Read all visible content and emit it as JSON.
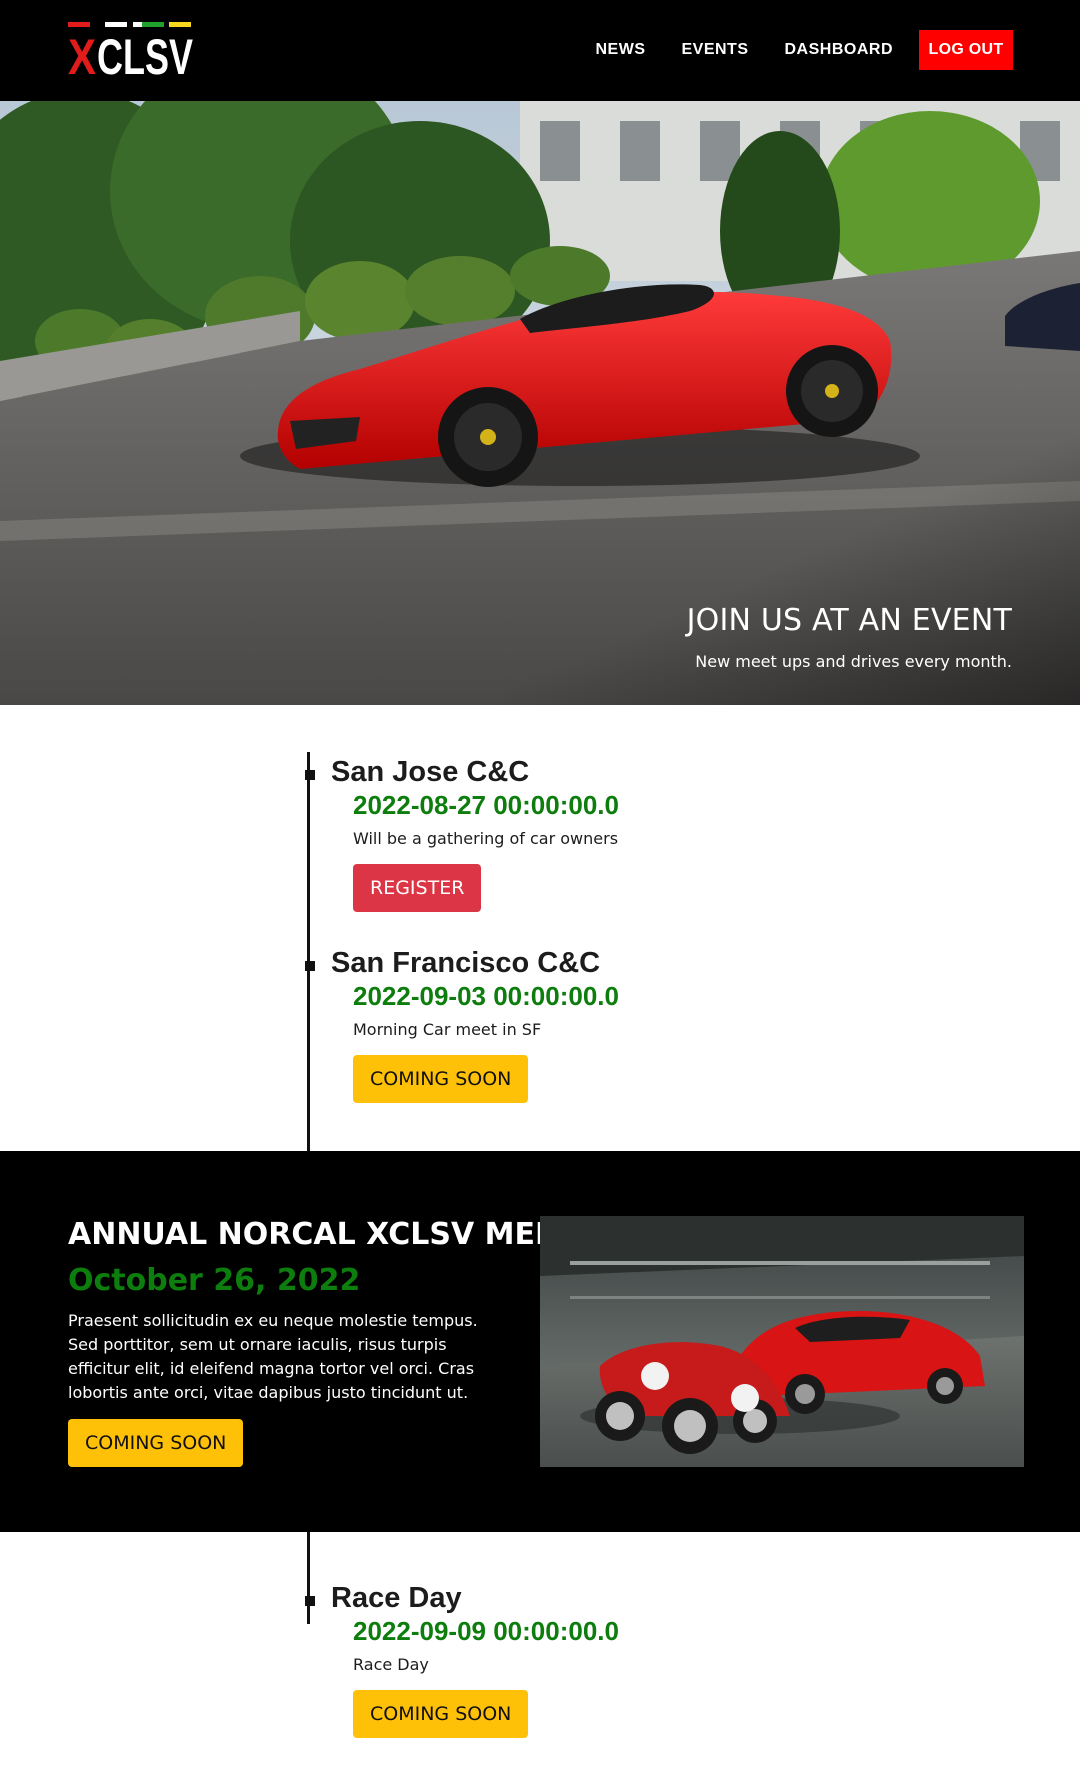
{
  "nav": {
    "logo_text": "XCLSV",
    "links": [
      "NEWS",
      "EVENTS",
      "DASHBOARD"
    ],
    "logout_label": "LOG OUT"
  },
  "hero": {
    "title": "JOIN US AT AN EVENT",
    "subtitle": "New meet ups and drives every month."
  },
  "events": [
    {
      "name": "San Jose C&C",
      "date": "2022-08-27 00:00:00.0",
      "description": "Will be a gathering of car owners",
      "button": "REGISTER"
    },
    {
      "name": "San Francisco C&C",
      "date": "2022-09-03 00:00:00.0",
      "description": "Morning Car meet in SF",
      "button": "COMING SOON"
    },
    {
      "name": "Race Day",
      "date": "2022-09-09 00:00:00.0",
      "description": "Race Day",
      "button": "COMING SOON"
    }
  ],
  "feature": {
    "title": "ANNUAL NORCAL XCLSV MEET",
    "date": "October 26, 2022",
    "text": "Praesent sollicitudin ex eu neque molestie tempus. Sed porttitor, sem ut ornare iaculis, risus turpis efficitur elit, id eleifend magna tortor vel orci. Cras lobortis ante orci, vitae dapibus justo tincidunt ut.",
    "button": "COMING SOON"
  },
  "colors": {
    "brand_red": "#ff0000",
    "date_green": "#0d7d0d",
    "register_red": "#dc3545",
    "coming_soon_yellow": "#ffc107"
  }
}
